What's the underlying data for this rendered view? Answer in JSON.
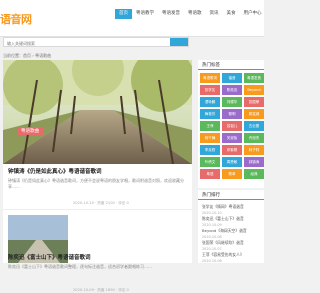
{
  "site": {
    "logo": "语音网"
  },
  "nav": [
    {
      "label": "首页",
      "active": true
    },
    {
      "label": "粤语教学"
    },
    {
      "label": "粤语发音"
    },
    {
      "label": "粤语歌"
    },
    {
      "label": "资讯"
    },
    {
      "label": "美食"
    },
    {
      "label": "用户中心"
    }
  ],
  "search": {
    "placeholder": "输入关键词搜索"
  },
  "breadcrumb": "当前位置：首页 › 粤语歌曲",
  "posts": [
    {
      "category": "粤语歌曲",
      "title": "钟镇涛《仍是如此真心》粤语谐音歌词",
      "excerpt": "钟镇涛《仍是如此真心》粤语谐音歌词，方便不会说粤语的朋友学唱，歌词附谐音对照，欢迎收藏分享……",
      "meta": "2020-10-10 · 热度 2100 · 评论 0"
    },
    {
      "title": "陈奕迅《富士山下》粤语谐音歌词",
      "excerpt": "陈奕迅《富士山下》粤语谐音歌词整理，逐句标注谐音，适合初学者跟唱练习……",
      "meta": "2020-10-09 · 热度 1890 · 评论 0"
    }
  ],
  "sidebar": {
    "tags_title": "热门标签",
    "tags": [
      {
        "label": "粤语歌词",
        "color": "#f79a1d"
      },
      {
        "label": "谐音",
        "color": "#31a6d8"
      },
      {
        "label": "粤语发音",
        "color": "#5cb85c"
      },
      {
        "label": "张学友",
        "color": "#e86b6b"
      },
      {
        "label": "陈奕迅",
        "color": "#9b6bcc"
      },
      {
        "label": "Beyond",
        "color": "#f79a1d"
      },
      {
        "label": "谭咏麟",
        "color": "#31a6d8"
      },
      {
        "label": "刘德华",
        "color": "#5cb85c"
      },
      {
        "label": "张国荣",
        "color": "#e86b6b"
      },
      {
        "label": "梅艳芳",
        "color": "#31a6d8"
      },
      {
        "label": "黎明",
        "color": "#9b6bcc"
      },
      {
        "label": "郭富城",
        "color": "#f79a1d"
      },
      {
        "label": "王菲",
        "color": "#5cb85c"
      },
      {
        "label": "容祖儿",
        "color": "#e86b6b"
      },
      {
        "label": "古巨基",
        "color": "#31a6d8"
      },
      {
        "label": "杨千嬅",
        "color": "#f79a1d"
      },
      {
        "label": "关淑怡",
        "color": "#9b6bcc"
      },
      {
        "label": "许冠杰",
        "color": "#5cb85c"
      },
      {
        "label": "李克勤",
        "color": "#31a6d8"
      },
      {
        "label": "邓紫棋",
        "color": "#e86b6b"
      },
      {
        "label": "林子祥",
        "color": "#f79a1d"
      },
      {
        "label": "叶倩文",
        "color": "#5cb85c"
      },
      {
        "label": "周慧敏",
        "color": "#31a6d8"
      },
      {
        "label": "钟镇涛",
        "color": "#9b6bcc"
      },
      {
        "label": "粤语",
        "color": "#e86b6b"
      },
      {
        "label": "歌单",
        "color": "#f79a1d"
      },
      {
        "label": "经典",
        "color": "#5cb85c"
      }
    ],
    "rank_title": "热门排行",
    "rank": [
      {
        "title": "张学友《情网》粤语谐音",
        "date": "2020-10-10"
      },
      {
        "title": "陈奕迅《富士山下》谐音",
        "date": "2020-10-09"
      },
      {
        "title": "Beyond《海阔天空》谐音",
        "date": "2020-10-08"
      },
      {
        "title": "张国荣《风继续吹》谐音",
        "date": "2020-10-07"
      },
      {
        "title": "王菲《容易受伤的女人》",
        "date": "2020-10-06"
      }
    ]
  }
}
